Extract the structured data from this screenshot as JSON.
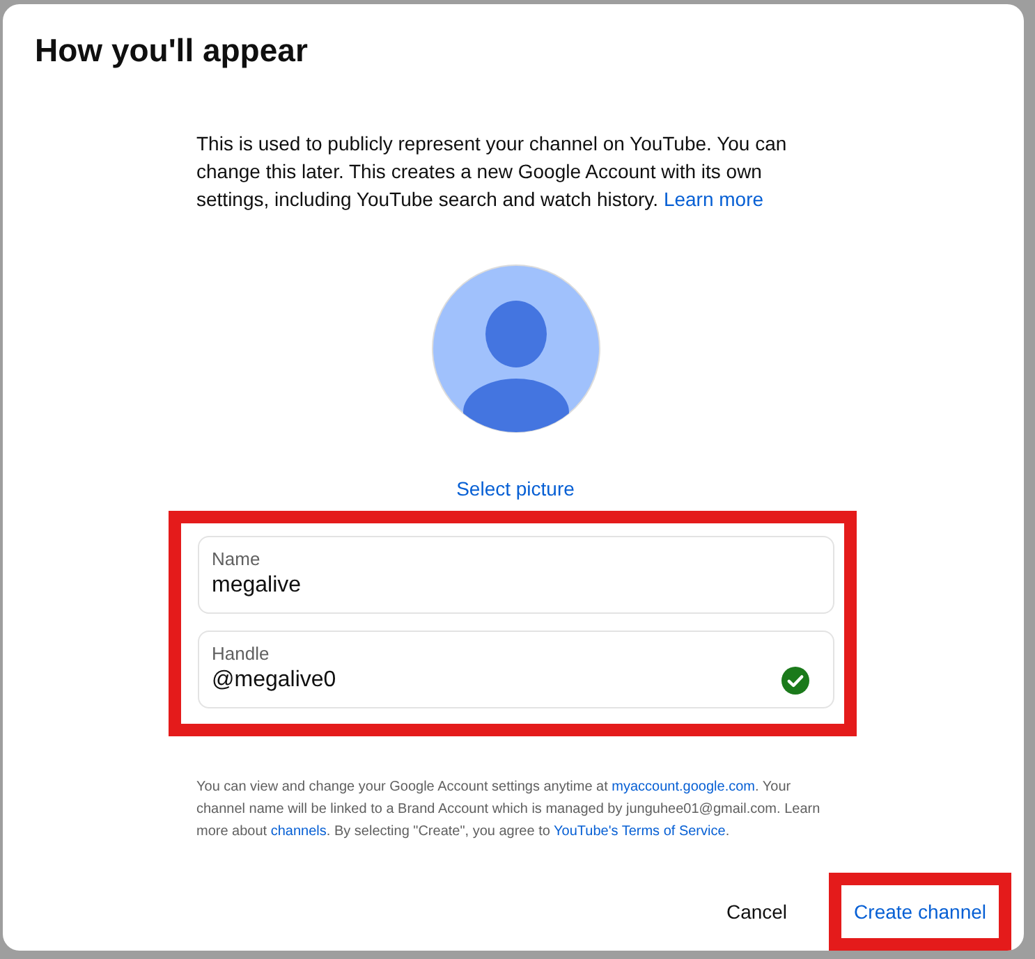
{
  "dialog": {
    "title": "How you'll appear",
    "intro": [
      {
        "kind": "text",
        "text": "This is used to publicly represent your channel on YouTube. You can change this later. This creates a new Google Account with its own settings, including YouTube search and watch history. "
      },
      {
        "kind": "link",
        "text": "Learn more"
      }
    ],
    "avatar": {
      "action": "Select picture"
    },
    "form": {
      "highlighted": true,
      "fields": [
        {
          "label": "Name",
          "value": "megalive",
          "valid": false
        },
        {
          "label": "Handle",
          "value": "@megalive0",
          "valid": true
        }
      ]
    },
    "legal": [
      {
        "kind": "text",
        "text": "You can view and change your Google Account settings anytime at "
      },
      {
        "kind": "link",
        "text": "myaccount.google.com"
      },
      {
        "kind": "text",
        "text": ". Your channel name will be linked to a Brand Account which is managed by junguhee01@gmail.com. Learn more about "
      },
      {
        "kind": "link",
        "text": "channels"
      },
      {
        "kind": "text",
        "text": ". By selecting \"Create\", you agree to "
      },
      {
        "kind": "link",
        "text": "YouTube's Terms of Service"
      },
      {
        "kind": "text",
        "text": "."
      }
    ],
    "buttons": [
      {
        "label": "Cancel",
        "kind": "text",
        "highlighted": false
      },
      {
        "label": "Create channel",
        "kind": "primary",
        "highlighted": true
      }
    ]
  }
}
